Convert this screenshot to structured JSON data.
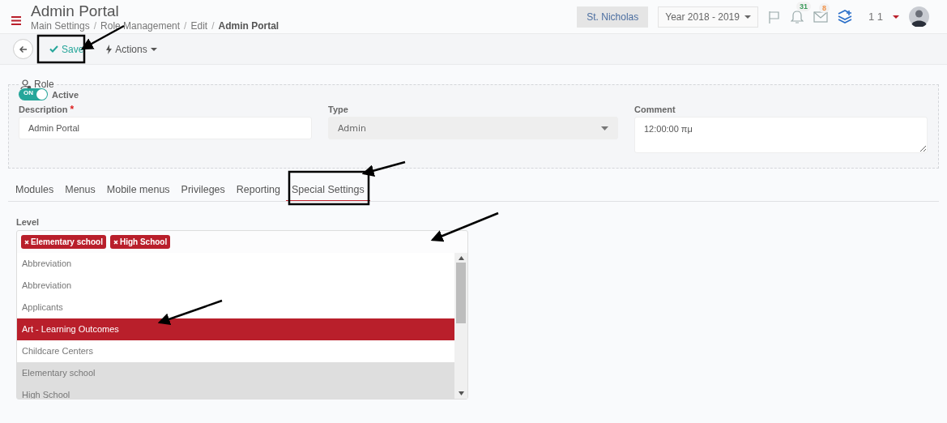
{
  "header": {
    "title": "Admin Portal",
    "separator": "/",
    "breadcrumb": [
      {
        "label": "Main Settings",
        "current": false
      },
      {
        "label": "Role Management",
        "current": false
      },
      {
        "label": "Edit",
        "current": false
      },
      {
        "label": "Admin Portal",
        "current": true
      }
    ],
    "school": "St. Nicholas",
    "year": "Year 2018 - 2019",
    "notifications": "31",
    "messages": "8",
    "user": "1 1"
  },
  "toolbar": {
    "save": "Save",
    "actions": "Actions"
  },
  "role": {
    "legend": "Role",
    "toggle": {
      "label": "ON",
      "on": true
    },
    "active_label": "Active",
    "description": {
      "label": "Description",
      "required_mark": "*",
      "value": "Admin Portal"
    },
    "type": {
      "label": "Type",
      "value": "Admin",
      "disabled": true
    },
    "comment": {
      "label": "Comment",
      "value": "12:00:00 πμ"
    }
  },
  "tabs": [
    {
      "label": "Modules",
      "selected": false
    },
    {
      "label": "Menus",
      "selected": false
    },
    {
      "label": "Mobile menus",
      "selected": false
    },
    {
      "label": "Privileges",
      "selected": false
    },
    {
      "label": "Reporting",
      "selected": false
    },
    {
      "label": "Special Settings",
      "selected": true
    }
  ],
  "level": {
    "label": "Level",
    "tags": [
      "Elementary school",
      "High School"
    ],
    "options": [
      {
        "label": "Abbreviation",
        "highlighted": false,
        "chosen": false
      },
      {
        "label": "Abbreviation",
        "highlighted": false,
        "chosen": false
      },
      {
        "label": "Applicants",
        "highlighted": false,
        "chosen": false
      },
      {
        "label": "Art - Learning Outcomes",
        "highlighted": true,
        "chosen": false
      },
      {
        "label": "Childcare Centers",
        "highlighted": false,
        "chosen": false
      },
      {
        "label": "Elementary school",
        "highlighted": false,
        "chosen": true
      },
      {
        "label": "High School",
        "highlighted": false,
        "chosen": true
      }
    ]
  }
}
